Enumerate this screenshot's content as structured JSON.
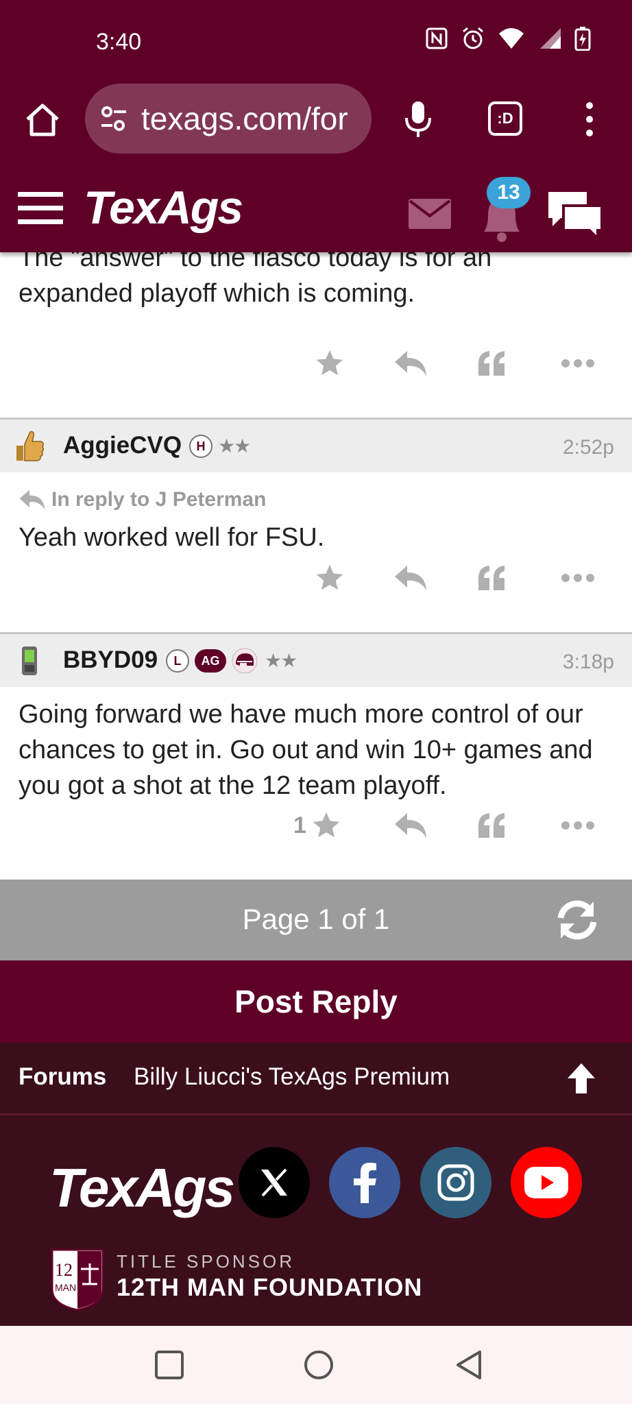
{
  "status_bar": {
    "time": "3:40"
  },
  "browser": {
    "url": "texags.com/for",
    "tab_icon_label": ":D"
  },
  "site_header": {
    "logo": "TexAgs",
    "notification_count": "13"
  },
  "posts": [
    {
      "body_partial_top": "The \"answer\" to the fiasco today is for an",
      "body": "expanded playoff which is coming."
    },
    {
      "username": "AggieCVQ",
      "badge": "H",
      "stars": "★★",
      "time": "2:52p",
      "reply_to": "In reply to J Peterman",
      "body": "Yeah worked well for FSU."
    },
    {
      "username": "BBYD09",
      "badge": "L",
      "badge_ag": "AG",
      "stars": "★★",
      "time": "3:18p",
      "body": "Going forward we have much more control of our chances to get in. Go out and win 10+ games and you got a shot at the 12 team playoff.",
      "like_count": "1"
    }
  ],
  "pager": {
    "label": "Page 1 of 1"
  },
  "post_reply": {
    "label": "Post Reply"
  },
  "breadcrumb": {
    "forums": "Forums",
    "board": "Billy Liucci's TexAgs Premium"
  },
  "footer": {
    "logo": "TexAgs",
    "sponsor_label": "TITLE SPONSOR",
    "sponsor_name": "12TH MAN FOUNDATION",
    "shield_top": "12",
    "shield_bottom": "MAN"
  },
  "colors": {
    "maroon": "#5f0026",
    "dark_maroon": "#3a0f1b",
    "badge_blue": "#3ba3d8",
    "pager_gray": "#9c9c9c"
  },
  "icons": [
    "home-icon",
    "tune-icon",
    "mic-icon",
    "more-vert-icon",
    "hamburger-icon",
    "mail-icon",
    "bell-icon",
    "chat-icon",
    "star-icon",
    "reply-icon",
    "quote-icon",
    "more-horiz-icon",
    "refresh-icon",
    "arrow-up-icon",
    "x-icon",
    "facebook-icon",
    "instagram-icon",
    "youtube-icon"
  ]
}
